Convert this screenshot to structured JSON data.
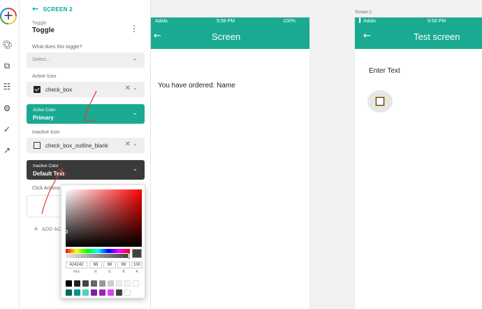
{
  "rail": {
    "icons": [
      "add-icon",
      "palette-icon",
      "screens-icon",
      "database-icon",
      "gear-icon",
      "publish-icon",
      "analytics-icon"
    ]
  },
  "panel": {
    "back_label": "SCREEN 2",
    "kicker": "Toggle",
    "title": "Toggle",
    "question_label": "What does this toggle?",
    "question_placeholder": "Select...",
    "active_icon_label": "Active Icon",
    "active_icon_value": "check_box",
    "active_color_label": "Active Color",
    "active_color_value": "Primary",
    "inactive_icon_label": "Inactive Icon",
    "inactive_icon_value": "check_box_outline_blank",
    "inactive_color_label": "Inactive Color",
    "inactive_color_value": "Default Text",
    "click_actions_label": "Click Actions",
    "add_action_label": "ADD AC"
  },
  "picker": {
    "hex": "424242",
    "r": "66",
    "g": "66",
    "b": "66",
    "a": "100",
    "labels": {
      "hex": "Hex",
      "r": "R",
      "g": "G",
      "b": "B",
      "a": "A"
    },
    "swatches_row1": [
      "#000000",
      "#222222",
      "#444444",
      "#666666",
      "#999999",
      "#cccccc",
      "#eeeeee",
      "#f5f5f5",
      "#ffffff"
    ],
    "swatches_row2": [
      "#00695c",
      "#009688",
      "#4dd0c4",
      "#7b1fa2",
      "#9c27b0",
      "#e040fb",
      "#424242",
      "#ffffff"
    ]
  },
  "screen1": {
    "carrier": "Adalo",
    "time": "9:58 PM",
    "battery": "100%",
    "title": "Screen",
    "body_text": "You have ordered: Name"
  },
  "screen2": {
    "label": "Screen 2",
    "carrier": "Adalo",
    "time": "9:58 PM",
    "title": "Test screen",
    "body_text": "Enter Text"
  },
  "colors": {
    "accent": "#00a896",
    "appbar": "#1aaa91",
    "inactive_field": "#3a3a3a",
    "annotation": "#e53935"
  }
}
